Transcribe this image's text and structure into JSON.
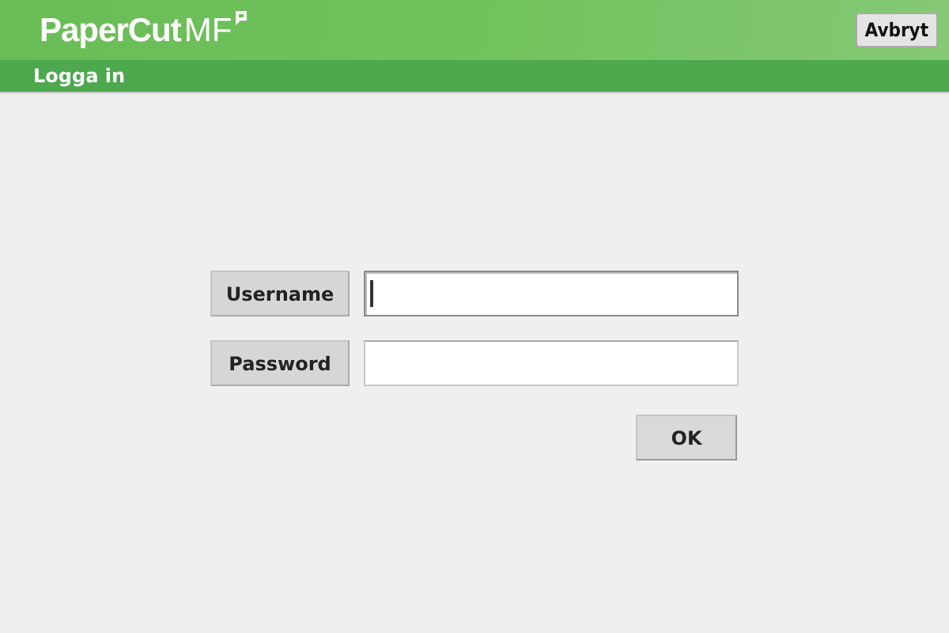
{
  "header": {
    "logo": {
      "name": "PaperCut",
      "suffix": "MF"
    },
    "cancel_button": "Avbryt"
  },
  "title_bar": {
    "title": "Logga in"
  },
  "form": {
    "fields": [
      {
        "label": "Username",
        "focused": true
      },
      {
        "label": "Password",
        "focused": false
      }
    ],
    "submit_button": "OK"
  }
}
